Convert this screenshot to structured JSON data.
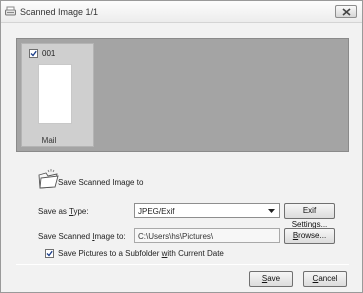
{
  "window": {
    "title": "Scanned Image 1/1",
    "close_icon": "close-icon"
  },
  "thumbnail": {
    "number": "001",
    "checked": true,
    "label": "Mail"
  },
  "save": {
    "section_title": "Save Scanned Image to",
    "type_label_pre": "Save as ",
    "type_label_key": "T",
    "type_label_post": "ype:",
    "type_value": "JPEG/Exif",
    "exif_button": "Exif Settings...",
    "path_label_pre": "Save Scanned ",
    "path_label_key": "I",
    "path_label_post": "mage to:",
    "path_value": "C:\\Users\\hs\\Pictures\\",
    "browse_key": "B",
    "browse_rest": "rowse...",
    "subfolder_pre": "Save Pictures to a Subfolder ",
    "subfolder_key": "w",
    "subfolder_post": "ith Current Date",
    "subfolder_checked": true
  },
  "footer": {
    "save_key": "S",
    "save_rest": "ave",
    "cancel_key": "C",
    "cancel_rest": "ancel"
  }
}
